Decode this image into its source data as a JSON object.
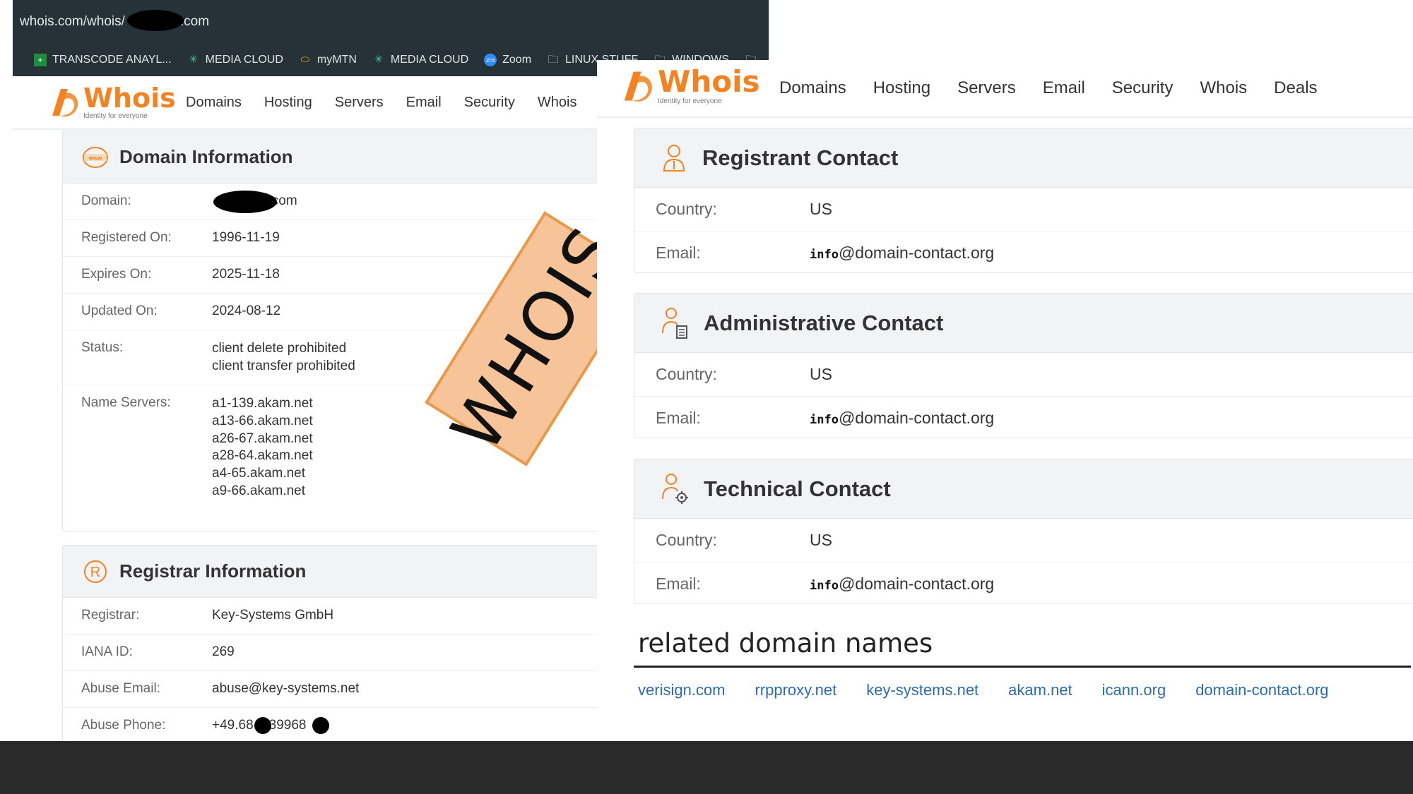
{
  "browser": {
    "url_prefix": "whois.com/whois/",
    "url_suffix": ".com",
    "bookmarks": [
      "TRANSCODE ANAYL...",
      "MEDIA CLOUD",
      "myMTN",
      "MEDIA CLOUD",
      "Zoom",
      "LINUX STUFF",
      "WINDOWS"
    ]
  },
  "site": {
    "logo_word": "Whois",
    "logo_tagline": "Identity for everyone",
    "nav_left": [
      "Domains",
      "Hosting",
      "Servers",
      "Email",
      "Security",
      "Whois"
    ],
    "nav_right": [
      "Domains",
      "Hosting",
      "Servers",
      "Email",
      "Security",
      "Whois",
      "Deals"
    ]
  },
  "domain_info": {
    "title": "Domain Information",
    "domain_label": "Domain:",
    "domain_value_suffix": "s.com",
    "registered_label": "Registered On:",
    "registered_value": "1996-11-19",
    "expires_label": "Expires On:",
    "expires_value": "2025-11-18",
    "updated_label": "Updated On:",
    "updated_value": "2024-08-12",
    "status_label": "Status:",
    "status_values": [
      "client delete prohibited",
      "client transfer prohibited"
    ],
    "nameservers_label": "Name Servers:",
    "nameservers": [
      "a1-139.akam.net",
      "a13-66.akam.net",
      "a26-67.akam.net",
      "a28-64.akam.net",
      "a4-65.akam.net",
      "a9-66.akam.net"
    ]
  },
  "registrar_info": {
    "title": "Registrar Information",
    "registrar_label": "Registrar:",
    "registrar_value": "Key-Systems GmbH",
    "iana_label": "IANA ID:",
    "iana_value": "269",
    "abuse_email_label": "Abuse Email:",
    "abuse_email_value": "abuse@key-systems.net",
    "abuse_phone_label": "Abuse Phone:",
    "abuse_phone_part1": "+49.68",
    "abuse_phone_part2": "39968"
  },
  "stamp_text": "WHOIS",
  "contacts": [
    {
      "title": "Registrant Contact",
      "country_label": "Country:",
      "country": "US",
      "email_label": "Email:",
      "email_prefix": "info",
      "email_domain": "@domain-contact.org"
    },
    {
      "title": "Administrative Contact",
      "country_label": "Country:",
      "country": "US",
      "email_label": "Email:",
      "email_prefix": "info",
      "email_domain": "@domain-contact.org"
    },
    {
      "title": "Technical Contact",
      "country_label": "Country:",
      "country": "US",
      "email_label": "Email:",
      "email_prefix": "info",
      "email_domain": "@domain-contact.org"
    }
  ],
  "related": {
    "title": "related domain names",
    "links": [
      "verisign.com",
      "rrpproxy.net",
      "key-systems.net",
      "akam.net",
      "icann.org",
      "domain-contact.org"
    ]
  },
  "colors": {
    "brand_orange": "#f58220",
    "link_blue": "#2b6cb0",
    "browser_dark": "#263238",
    "stamp_fill": "#f7c49a"
  }
}
